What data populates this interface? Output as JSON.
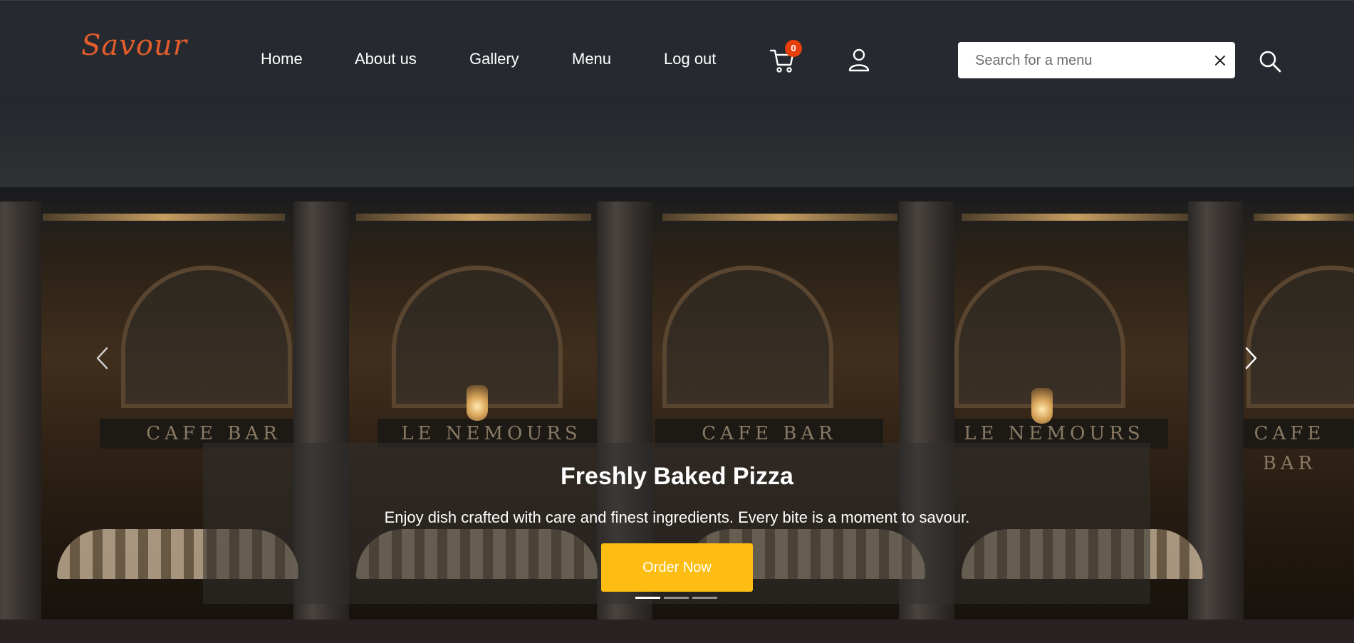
{
  "header": {
    "logo": "Savour",
    "nav": [
      {
        "label": "Home"
      },
      {
        "label": "About us"
      },
      {
        "label": "Gallery"
      },
      {
        "label": "Menu"
      },
      {
        "label": "Log out"
      }
    ],
    "cart": {
      "icon": "cart-icon",
      "count": "0"
    },
    "user_icon": "user-icon",
    "search": {
      "placeholder": "Search for a menu",
      "value": "",
      "clear_icon": "close-icon",
      "button_icon": "search-icon"
    }
  },
  "hero": {
    "signs": [
      "CAFE BAR",
      "LE NEMOURS",
      "CAFE BAR",
      "LE NEMOURS",
      "CAFE BAR"
    ],
    "title": "Freshly Baked Pizza",
    "text": "Enjoy dish crafted with care and finest ingredients. Every bite is a moment to savour.",
    "button_label": "Order Now",
    "prev_icon": "chevron-left-icon",
    "next_icon": "chevron-right-icon",
    "slides_total": 3,
    "active_slide": 1
  },
  "colors": {
    "nav_bg": "#262a30",
    "logo": "#e35d2c",
    "badge": "#e8400c",
    "order_button": "#fdbd12",
    "footer_bg": "#2a2222"
  }
}
